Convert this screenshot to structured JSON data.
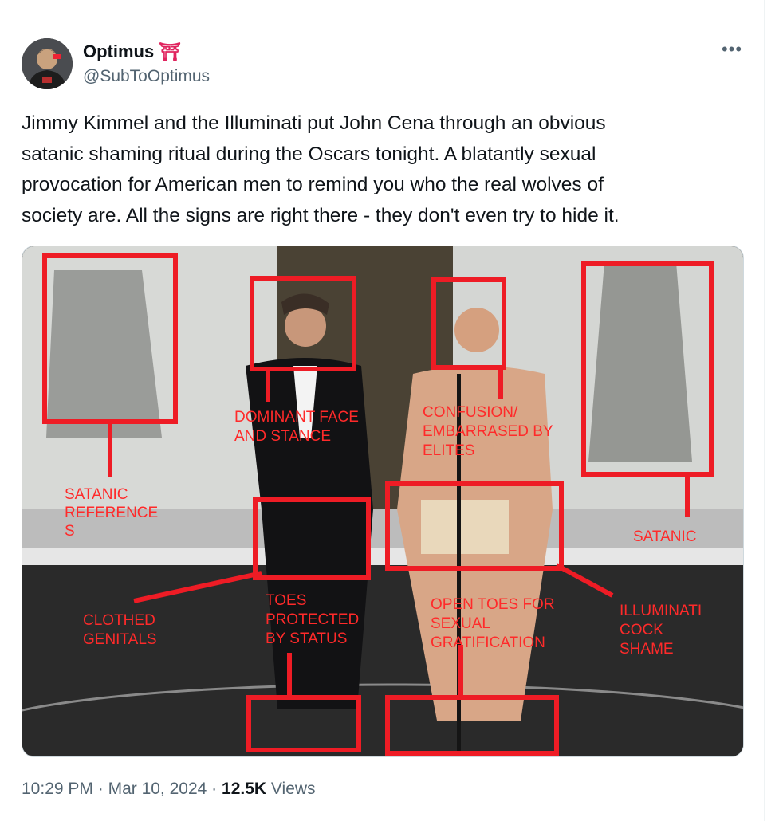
{
  "author": {
    "display_name": "Optimus",
    "badge_emoji": "⛩",
    "handle": "@SubToOptimus"
  },
  "tweet": {
    "text": "Jimmy Kimmel and the Illuminati put John Cena through an obvious\nsatanic shaming ritual during the Oscars tonight. A blatantly sexual\nprovocation for American men to remind you who the real wolves of\nsociety are. All the signs are right there - they don't even try to hide it.",
    "time": "10:29 PM",
    "separator": "·",
    "date": "Mar 10, 2024",
    "views_count": "12.5K",
    "views_label": "Views"
  },
  "media": {
    "annotations": {
      "satanic_left": [
        "SATANIC",
        "REFERENCE",
        "S"
      ],
      "dominant": [
        "DOMINANT FACE",
        "AND STANCE"
      ],
      "confusion": [
        "CONFUSION/",
        "EMBARRASED BY",
        "ELITES"
      ],
      "satanic_right": "SATANIC",
      "clothed": [
        "CLOTHED",
        "GENITALS"
      ],
      "toes_protected": [
        "TOES",
        "PROTECTED",
        "BY STATUS"
      ],
      "open_toes": [
        "OPEN TOES FOR",
        "SEXUAL",
        "GRATIFICATION"
      ],
      "illuminati": [
        "ILLUMINATI",
        "COCK",
        "SHAME"
      ]
    }
  },
  "more_icon": "more-horizontal-icon",
  "colors": {
    "annotation": "#ff2a2a",
    "muted": "#536471"
  }
}
